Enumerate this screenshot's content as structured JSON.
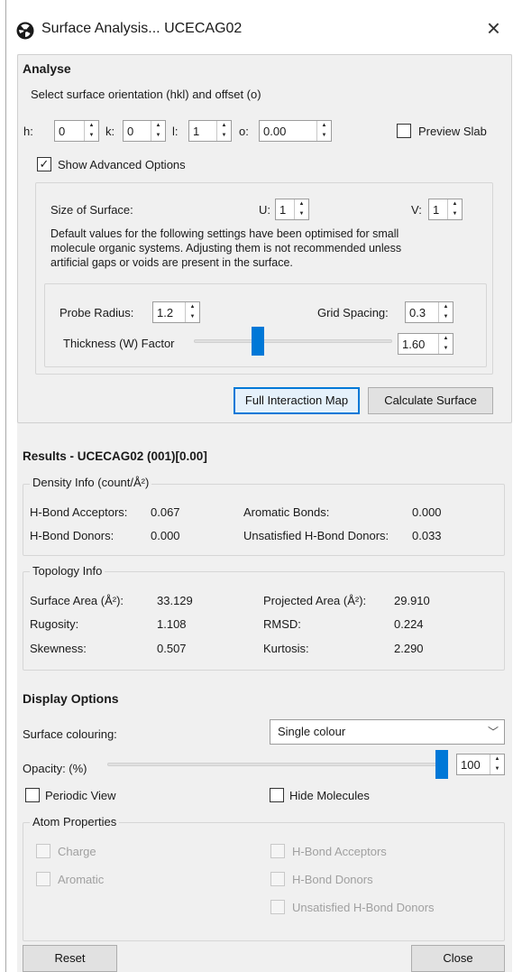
{
  "window": {
    "title": "Surface Analysis... UCECAG02",
    "close_label": "×"
  },
  "analyse": {
    "heading": "Analyse",
    "orientation_group": "Select surface orientation (hkl) and offset (o)",
    "h_label": "h:",
    "h_value": "0",
    "k_label": "k:",
    "k_value": "0",
    "l_label": "l:",
    "l_value": "1",
    "o_label": "o:",
    "o_value": "0.00",
    "preview_slab": {
      "label": "Preview Slab",
      "checked": false
    },
    "show_advanced": {
      "label": "Show Advanced Options",
      "checked": true
    },
    "size_of_surface_label": "Size of Surface:",
    "u_label": "U:",
    "u_value": "1",
    "v_label": "V:",
    "v_value": "1",
    "default_note_line1": "Default values for the following settings have been optimised for small",
    "default_note_line2": "molecule organic systems. Adjusting them is not recommended unless",
    "default_note_line3": "artificial gaps or voids are present in the surface.",
    "probe_radius_label": "Probe Radius:",
    "probe_radius_value": "1.2",
    "grid_spacing_label": "Grid Spacing:",
    "grid_spacing_value": "0.3",
    "thickness_label": "Thickness (W) Factor",
    "thickness_value": "1.60",
    "thickness_slider_fraction": 0.31,
    "full_interaction_map_button": "Full Interaction Map",
    "calculate_surface_button": "Calculate Surface"
  },
  "results": {
    "heading": "Results - UCECAG02 (001)[0.00]",
    "density_group": "Density Info (count/Å²)",
    "hbond_acceptors_label": "H-Bond Acceptors:",
    "hbond_acceptors_value": "0.067",
    "aromatic_bonds_label": "Aromatic Bonds:",
    "aromatic_bonds_value": "0.000",
    "hbond_donors_label": "H-Bond Donors:",
    "hbond_donors_value": "0.000",
    "unsat_hbond_donors_label": "Unsatisfied H-Bond Donors:",
    "unsat_hbond_donors_value": "0.033",
    "topology_group": "Topology Info",
    "surface_area_label": "Surface Area (Å²):",
    "surface_area_value": "33.129",
    "projected_area_label": "Projected Area (Å²):",
    "projected_area_value": "29.910",
    "rugosity_label": "Rugosity:",
    "rugosity_value": "1.108",
    "rmsd_label": "RMSD:",
    "rmsd_value": "0.224",
    "skewness_label": "Skewness:",
    "skewness_value": "0.507",
    "kurtosis_label": "Kurtosis:",
    "kurtosis_value": "2.290"
  },
  "display": {
    "heading": "Display Options",
    "surface_colouring_label": "Surface colouring:",
    "surface_colouring_value": "Single colour",
    "opacity_label": "Opacity: (%)",
    "opacity_value": "100",
    "opacity_slider_fraction": 1.0,
    "periodic_view": {
      "label": "Periodic View",
      "checked": false
    },
    "hide_molecules": {
      "label": "Hide Molecules",
      "checked": false
    },
    "atom_props_group": "Atom Properties",
    "charge_label": "Charge",
    "aromatic_label": "Aromatic",
    "hbond_acceptors_label": "H-Bond Acceptors",
    "hbond_donors_label": "H-Bond Donors",
    "unsat_hbond_donors_label": "Unsatisfied H-Bond Donors"
  },
  "footer": {
    "reset_button": "Reset",
    "close_button": "Close"
  },
  "colors": {
    "accent": "#0078d7",
    "panel": "#f0f0f0",
    "border": "#d6d6d6"
  }
}
